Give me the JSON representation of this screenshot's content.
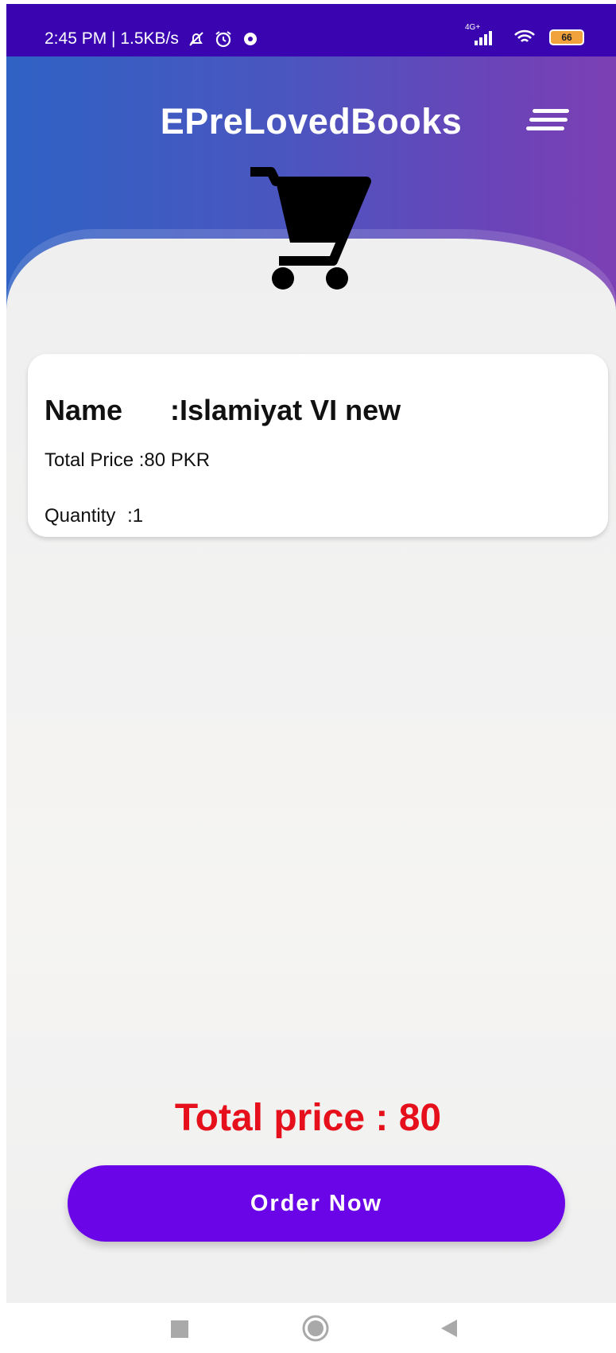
{
  "status_bar": {
    "time_speed": "2:45 PM | 1.5KB/s",
    "network_label": "4G+",
    "battery_level": "66",
    "icons": [
      "mute-icon",
      "alarm-icon",
      "settings-icon",
      "signal-icon",
      "wifi-icon",
      "battery-icon"
    ]
  },
  "header": {
    "title": "EPreLovedBooks",
    "menu_icon": "menu-icon",
    "cart_icon": "shopping-cart-icon"
  },
  "cart_items": [
    {
      "name_label": "Name",
      "name_value": ":Islamiyat VI new",
      "price_label": "Total Price",
      "price_value": ":80 PKR",
      "quantity_label": "Quantity",
      "quantity_value": ":1"
    }
  ],
  "footer": {
    "total_text": "Total price : 80",
    "order_button_label": "Order Now"
  },
  "nav_bar": {
    "icons": [
      "recent-apps-icon",
      "home-icon",
      "back-icon"
    ]
  },
  "colors": {
    "status_bar": "#3a05b0",
    "header_gradient_start": "#2f62c4",
    "header_gradient_end": "#7c40b4",
    "total_price": "#e5101b",
    "order_button": "#6a05e8"
  }
}
